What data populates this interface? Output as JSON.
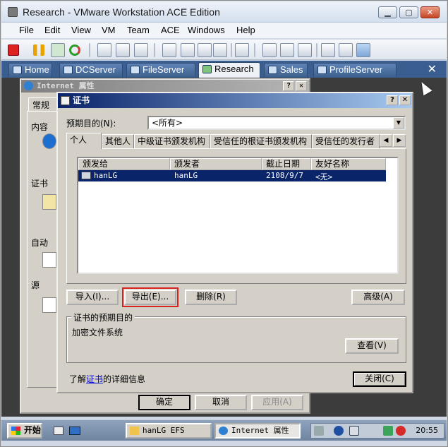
{
  "window": {
    "title": "Research - VMware Workstation ACE Edition",
    "min": "▁",
    "max": "▢",
    "close": "✕"
  },
  "menu": [
    "File",
    "Edit",
    "View",
    "VM",
    "Team",
    "ACE",
    "Windows",
    "Help"
  ],
  "tabs": [
    "Home",
    "DCServer",
    "FileServer",
    "Research",
    "Sales",
    "ProfileServer"
  ],
  "active_tab": "Research",
  "tabs_close": "✕",
  "internet_props": {
    "title": "Internet 属性",
    "help_btn": "?",
    "close_btn": "✕",
    "tab_general": "常规",
    "labels": [
      "内容",
      "证书",
      "自动",
      "源"
    ],
    "buttons": {
      "ok": "确定",
      "cancel": "取消",
      "apply": "应用(A)"
    }
  },
  "cert_dialog": {
    "title": "证书",
    "help_btn": "?",
    "close_btn": "✕",
    "purpose_label": "预期目的(N):",
    "purpose_value": "<所有>",
    "tabs": [
      "个人",
      "其他人",
      "中级证书颁发机构",
      "受信任的根证书颁发机构",
      "受信任的发行者"
    ],
    "tab_arrows": [
      "◀",
      "▶"
    ],
    "columns": [
      "颁发给",
      "颁发者",
      "截止日期",
      "友好名称"
    ],
    "rows": [
      {
        "issued_to": "hanLG",
        "issued_by": "hanLG",
        "expires": "2108/9/7",
        "friendly": "<无>"
      }
    ],
    "buttons": {
      "import": "导入(I)...",
      "export": "导出(E)...",
      "delete": "删除(R)",
      "advanced": "高级(A)",
      "view": "查看(V)",
      "close": "关闭(C)"
    },
    "group_title": "证书的预期目的",
    "group_text": "加密文件系统",
    "info_prefix": "了解",
    "info_link": "证书",
    "info_suffix": "的详细信息"
  },
  "taskbar": {
    "start": "开始",
    "items": [
      "hanLG EFS",
      "Internet 属性"
    ],
    "clock": "20:55"
  }
}
